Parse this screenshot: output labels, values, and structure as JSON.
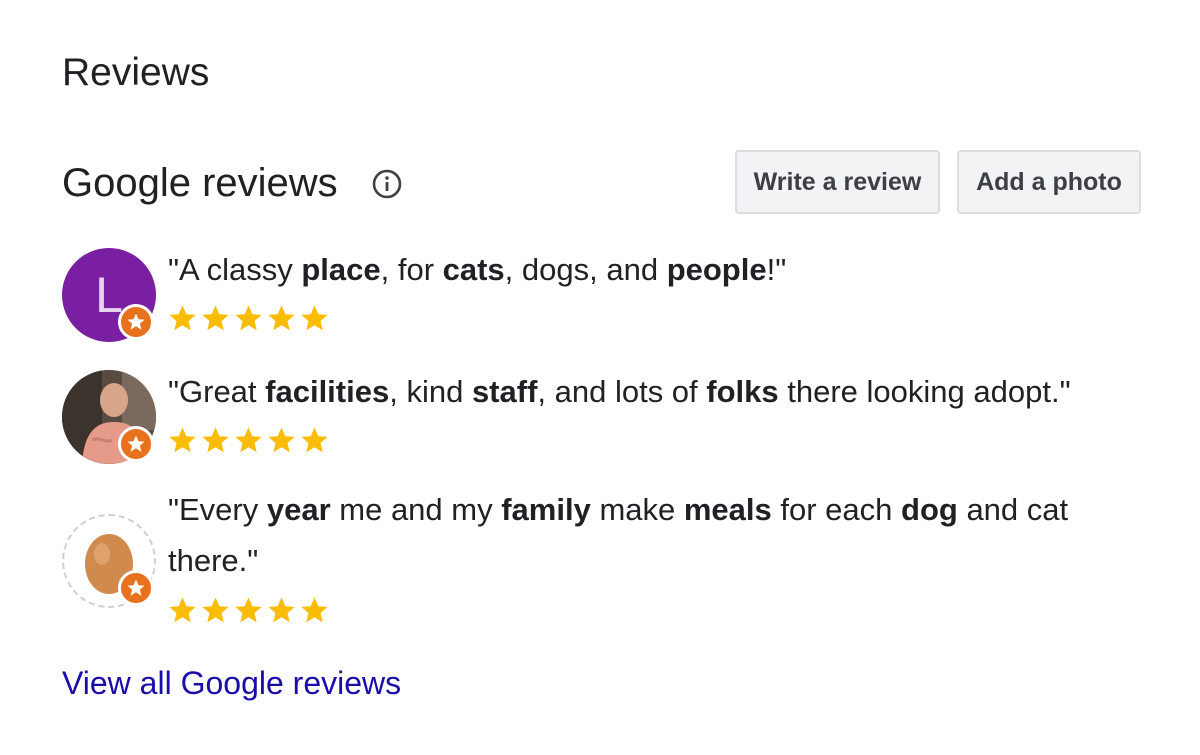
{
  "section_title": "Reviews",
  "reviews_header": {
    "title": "Google reviews",
    "info_icon": "info-icon",
    "write_review_label": "Write a review",
    "add_photo_label": "Add a photo"
  },
  "reviews": [
    {
      "avatar": {
        "type": "letter",
        "letter": "L",
        "bg": "#7b1fa2"
      },
      "quote_parts": [
        {
          "t": "\"A classy ",
          "b": false
        },
        {
          "t": "place",
          "b": true
        },
        {
          "t": ", for ",
          "b": false
        },
        {
          "t": "cats",
          "b": true
        },
        {
          "t": ", dogs, and ",
          "b": false
        },
        {
          "t": "people",
          "b": true
        },
        {
          "t": "!\"",
          "b": false
        }
      ],
      "rating": 5
    },
    {
      "avatar": {
        "type": "photo"
      },
      "quote_parts": [
        {
          "t": "\"Great ",
          "b": false
        },
        {
          "t": "facilities",
          "b": true
        },
        {
          "t": ", kind ",
          "b": false
        },
        {
          "t": "staff",
          "b": true
        },
        {
          "t": ", and lots of ",
          "b": false
        },
        {
          "t": "folks",
          "b": true
        },
        {
          "t": " there looking adopt.\"",
          "b": false
        }
      ],
      "rating": 5
    },
    {
      "avatar": {
        "type": "egg"
      },
      "quote_parts": [
        {
          "t": "\"Every ",
          "b": false
        },
        {
          "t": "year",
          "b": true
        },
        {
          "t": " me and my ",
          "b": false
        },
        {
          "t": "family",
          "b": true
        },
        {
          "t": " make ",
          "b": false
        },
        {
          "t": "meals",
          "b": true
        },
        {
          "t": " for each ",
          "b": false
        },
        {
          "t": "dog",
          "b": true
        },
        {
          "t": " and cat there.\"",
          "b": false
        }
      ],
      "rating": 5
    }
  ],
  "view_all_label": "View all Google reviews",
  "colors": {
    "star": "#fbbc04",
    "badge": "#e8711e",
    "link": "#1a0dab"
  }
}
